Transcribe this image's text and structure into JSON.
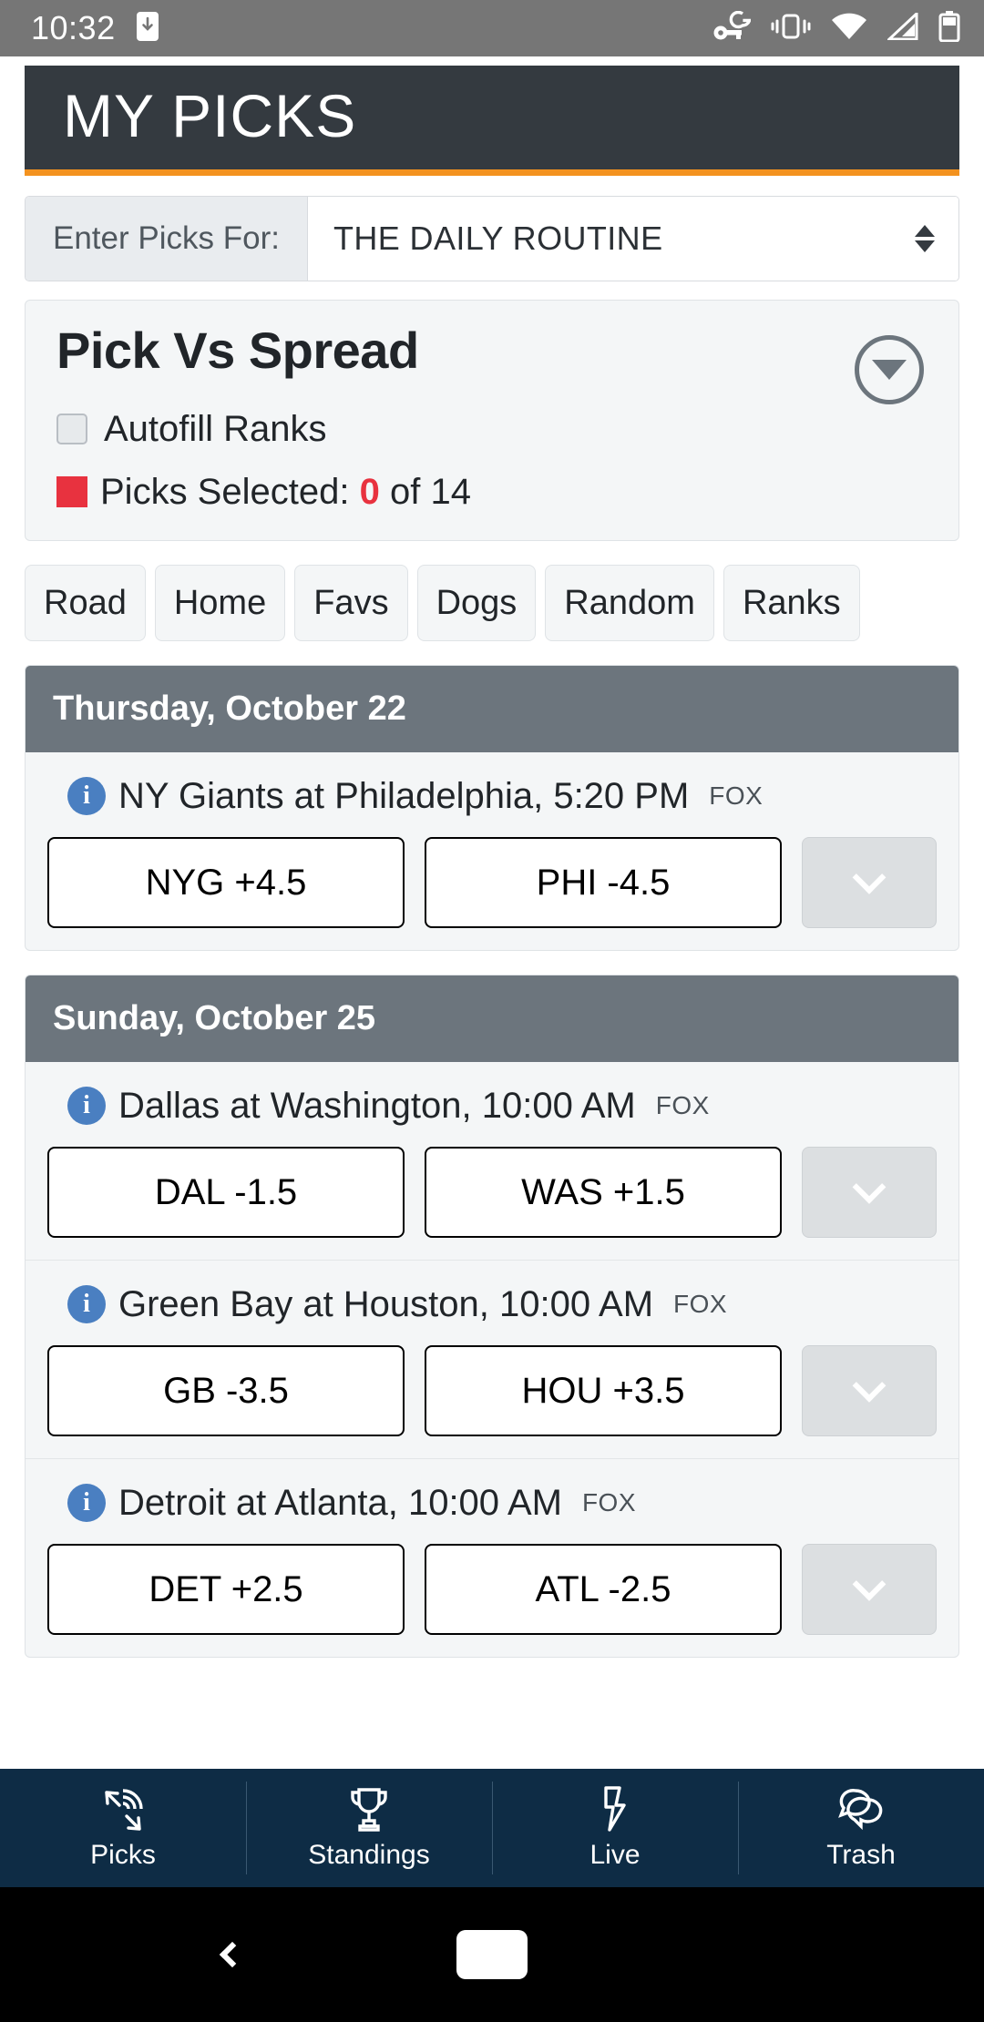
{
  "status_bar": {
    "time": "10:32",
    "icons": [
      "download-to-device-icon",
      "vpn-key-g-icon",
      "vibrate-icon",
      "wifi-icon",
      "cellular-signal-icon",
      "battery-icon"
    ]
  },
  "header": {
    "title": "MY PICKS",
    "bg_color": "#343a40",
    "accent_color": "#f3921f"
  },
  "pool_selector": {
    "label": "Enter Picks For:",
    "selected_value": "THE DAILY ROUTINE",
    "options": [
      "THE DAILY ROUTINE"
    ]
  },
  "pick_panel": {
    "title": "Pick Vs Spread",
    "collapse_icon": "chevron-down-circle-icon",
    "autofill_label": "Autofill Ranks",
    "autofill_checked": false,
    "picks_selected_prefix": "Picks Selected:",
    "picks_selected_count": "0",
    "picks_selected_suffix": "of 14",
    "picks_total": "14",
    "status_color": "#e8323f"
  },
  "filters": [
    {
      "label": "Road"
    },
    {
      "label": "Home"
    },
    {
      "label": "Favs"
    },
    {
      "label": "Dogs"
    },
    {
      "label": "Random"
    },
    {
      "label": "Ranks"
    }
  ],
  "day_groups": [
    {
      "date_label": "Thursday, October 22",
      "games": [
        {
          "info_icon": "info-icon",
          "matchup": "NY Giants at Philadelphia, 5:20 PM",
          "network": "FOX",
          "away_pick": "NYG +4.5",
          "home_pick": "PHI -4.5",
          "rank_placeholder": "chevron-down-icon"
        }
      ]
    },
    {
      "date_label": "Sunday, October 25",
      "games": [
        {
          "info_icon": "info-icon",
          "matchup": "Dallas at Washington, 10:00 AM",
          "network": "FOX",
          "away_pick": "DAL -1.5",
          "home_pick": "WAS +1.5",
          "rank_placeholder": "chevron-down-icon"
        },
        {
          "info_icon": "info-icon",
          "matchup": "Green Bay at Houston, 10:00 AM",
          "network": "FOX",
          "away_pick": "GB -3.5",
          "home_pick": "HOU +3.5",
          "rank_placeholder": "chevron-down-icon"
        },
        {
          "info_icon": "info-icon",
          "matchup": "Detroit at Atlanta, 10:00 AM",
          "network": "FOX",
          "away_pick": "DET +2.5",
          "home_pick": "ATL -2.5",
          "rank_placeholder": "chevron-down-icon"
        }
      ]
    }
  ],
  "tab_bar": {
    "bg_color": "#0e2c45",
    "tabs": [
      {
        "label": "Picks",
        "icon": "fingerprint-target-icon",
        "active": true
      },
      {
        "label": "Standings",
        "icon": "trophy-icon",
        "active": false
      },
      {
        "label": "Live",
        "icon": "lightning-bolt-icon",
        "active": false
      },
      {
        "label": "Trash",
        "icon": "chat-bubbles-icon",
        "active": false
      }
    ]
  },
  "system_nav": {
    "back": "back-chevron-icon",
    "home": "home-pill-icon"
  }
}
